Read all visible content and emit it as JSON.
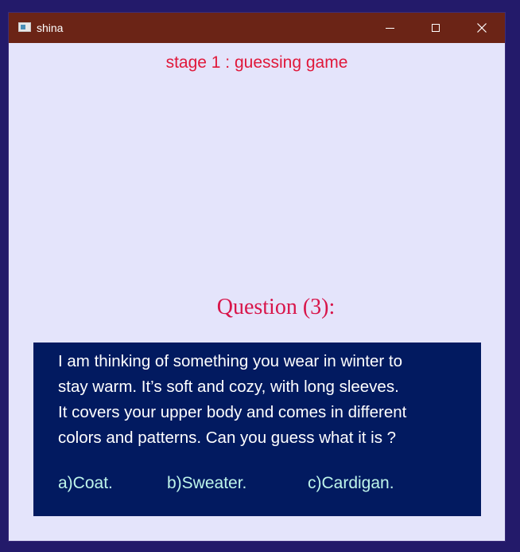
{
  "window": {
    "title": "shina"
  },
  "stage": {
    "title": "stage 1 : guessing game"
  },
  "question": {
    "heading": "Question (3):",
    "lines": [
      "I am thinking of something you wear in winter to",
      "stay warm. It’s soft and cozy, with long sleeves.",
      "It covers your upper body and comes in different",
      "colors and patterns. Can you guess what it is ?"
    ],
    "options": [
      "a)Coat.",
      "b)Sweater.",
      "c)Cardigan."
    ]
  },
  "icons": {
    "app": "window-app-icon",
    "minimize": "minimize-icon",
    "maximize": "maximize-icon",
    "close": "close-icon"
  },
  "colors": {
    "title_bar": "#6b2416",
    "window_bg": "#e4e4fb",
    "stage_title": "#e0183a",
    "question_heading": "#d8154a",
    "question_box": "#021a60",
    "question_text": "#ffffff",
    "options_text": "#bff5ea"
  }
}
